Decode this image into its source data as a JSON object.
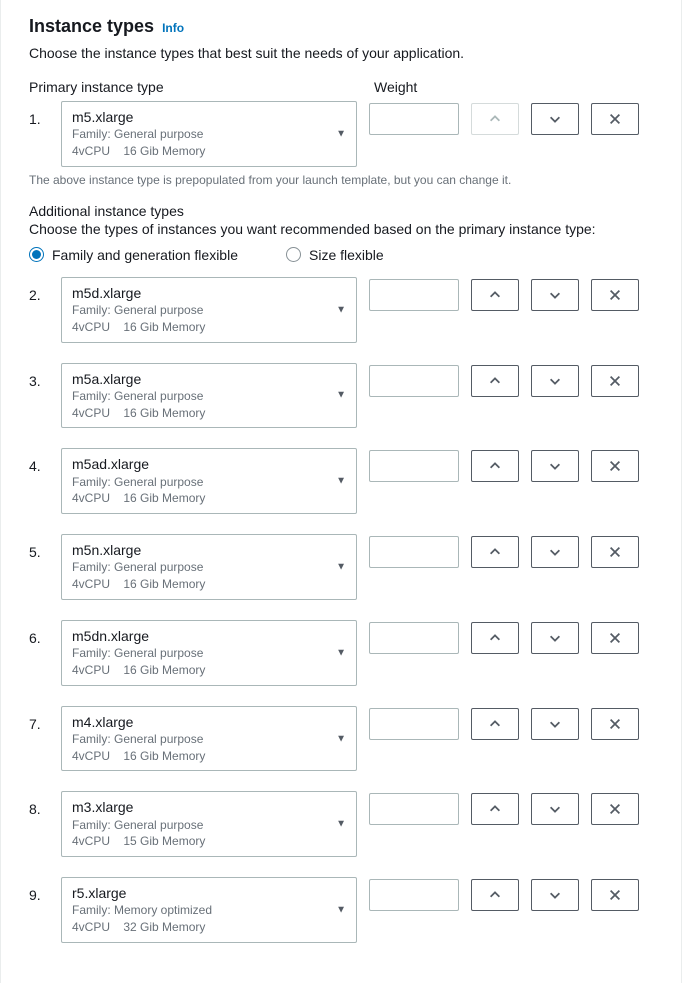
{
  "header": {
    "title": "Instance types",
    "info": "Info",
    "description": "Choose the instance types that best suit the needs of your application."
  },
  "columns": {
    "primary": "Primary instance type",
    "weight": "Weight"
  },
  "primary_row": {
    "number": "1.",
    "name": "m5.xlarge",
    "family": "Family: General purpose",
    "vcpu": "4vCPU",
    "memory": "16 Gib Memory"
  },
  "prepopulated_hint": "The above instance type is prepopulated from your launch template, but you can change it.",
  "additional": {
    "title": "Additional instance types",
    "description": "Choose the types of instances you want recommended based on the primary instance type:"
  },
  "flexibility": {
    "family": "Family and generation flexible",
    "size": "Size flexible",
    "selected": "family"
  },
  "rows": [
    {
      "number": "2.",
      "name": "m5d.xlarge",
      "family": "Family: General purpose",
      "vcpu": "4vCPU",
      "memory": "16 Gib Memory"
    },
    {
      "number": "3.",
      "name": "m5a.xlarge",
      "family": "Family: General purpose",
      "vcpu": "4vCPU",
      "memory": "16 Gib Memory"
    },
    {
      "number": "4.",
      "name": "m5ad.xlarge",
      "family": "Family: General purpose",
      "vcpu": "4vCPU",
      "memory": "16 Gib Memory"
    },
    {
      "number": "5.",
      "name": "m5n.xlarge",
      "family": "Family: General purpose",
      "vcpu": "4vCPU",
      "memory": "16 Gib Memory"
    },
    {
      "number": "6.",
      "name": "m5dn.xlarge",
      "family": "Family: General purpose",
      "vcpu": "4vCPU",
      "memory": "16 Gib Memory"
    },
    {
      "number": "7.",
      "name": "m4.xlarge",
      "family": "Family: General purpose",
      "vcpu": "4vCPU",
      "memory": "16 Gib Memory"
    },
    {
      "number": "8.",
      "name": "m3.xlarge",
      "family": "Family: General purpose",
      "vcpu": "4vCPU",
      "memory": "15 Gib Memory"
    },
    {
      "number": "9.",
      "name": "r5.xlarge",
      "family": "Family: Memory optimized",
      "vcpu": "4vCPU",
      "memory": "32 Gib Memory"
    }
  ]
}
